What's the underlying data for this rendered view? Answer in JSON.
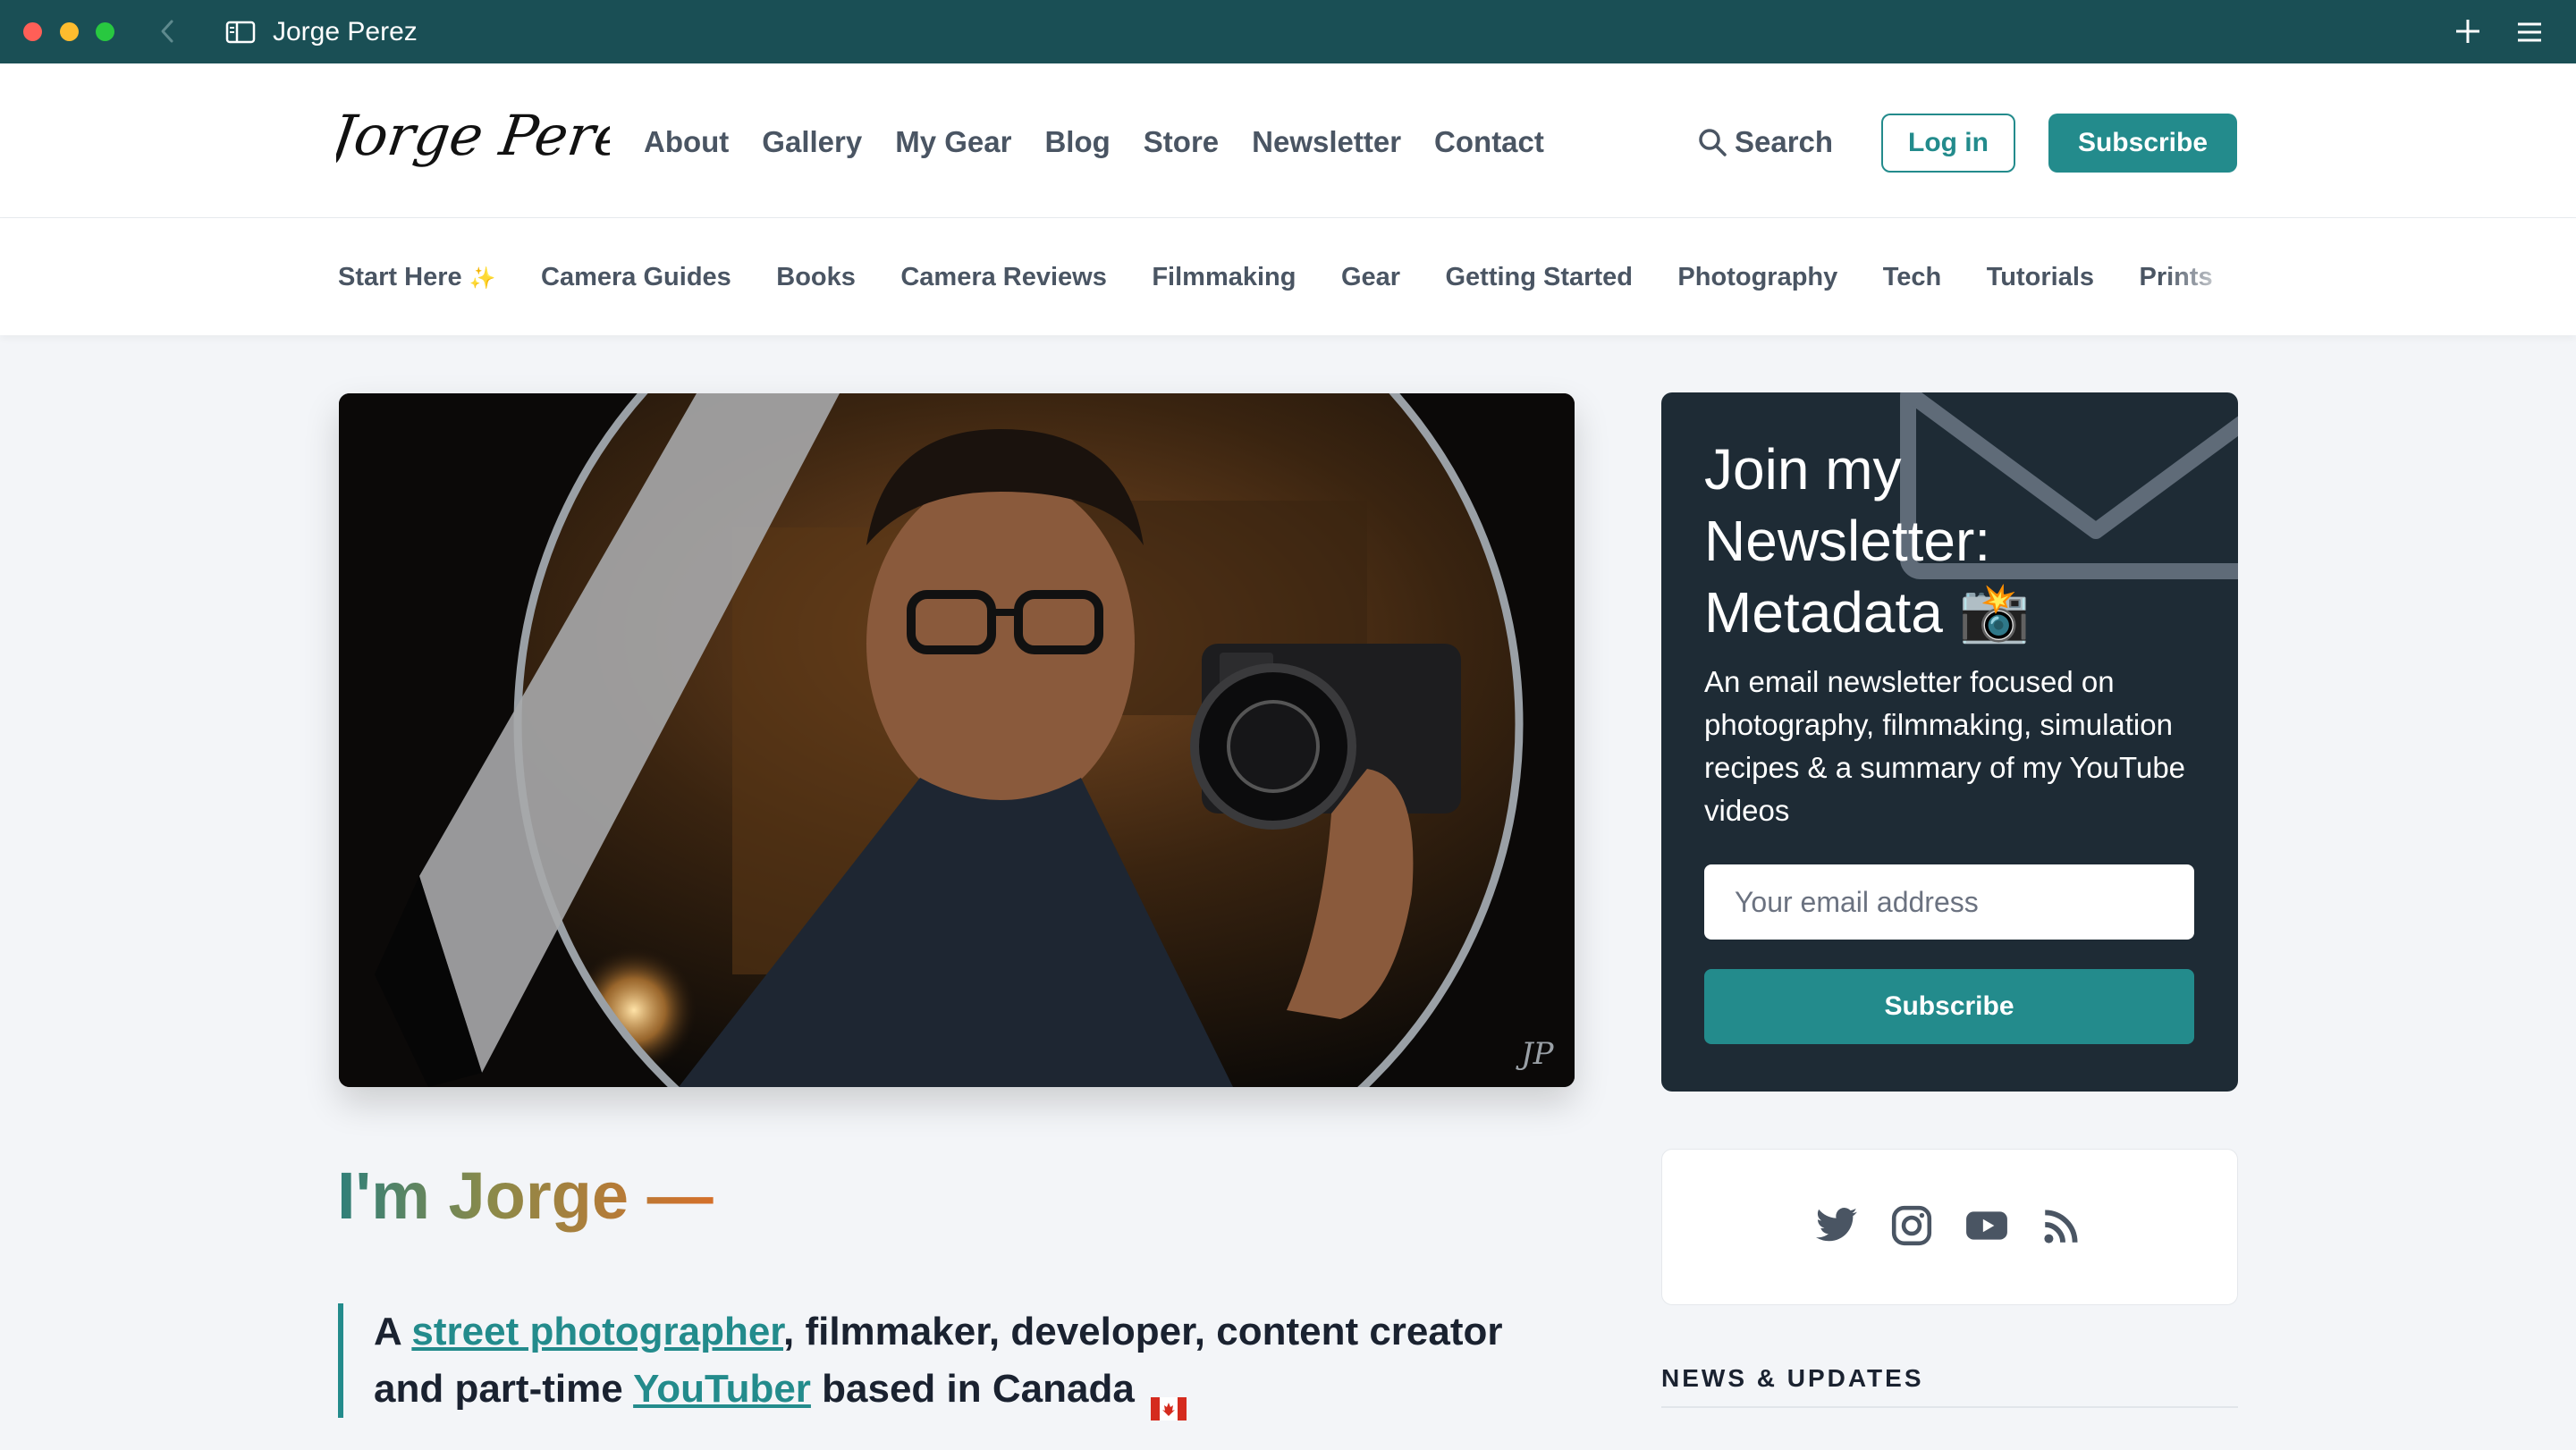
{
  "browser": {
    "tab_title": "Jorge Perez"
  },
  "header": {
    "logo_text": "Jorge Perez",
    "nav": [
      {
        "label": "About"
      },
      {
        "label": "Gallery"
      },
      {
        "label": "My Gear"
      },
      {
        "label": "Blog"
      },
      {
        "label": "Store"
      },
      {
        "label": "Newsletter"
      },
      {
        "label": "Contact"
      }
    ],
    "search_label": "Search",
    "login_label": "Log in",
    "subscribe_label": "Subscribe"
  },
  "categories": [
    {
      "label": "Start Here"
    },
    {
      "label": "Camera Guides"
    },
    {
      "label": "Books"
    },
    {
      "label": "Camera Reviews"
    },
    {
      "label": "Filmmaking"
    },
    {
      "label": "Gear"
    },
    {
      "label": "Getting Started"
    },
    {
      "label": "Photography"
    },
    {
      "label": "Tech"
    },
    {
      "label": "Tutorials"
    },
    {
      "label": "Prints"
    }
  ],
  "hero": {
    "watermark": "JP"
  },
  "intro": {
    "heading": "I'm Jorge —",
    "quote": {
      "prefix": "A ",
      "link1": "street photographer",
      "middle": ", filmmaker, developer, content creator and part-time ",
      "link2": "YouTuber",
      "suffix": " based in Canada"
    }
  },
  "newsletter": {
    "title": "Join my Newsletter: Metadata",
    "emoji": "📸",
    "description": "An email newsletter focused on photography, filmmaking, simulation recipes & a summary of my YouTube videos",
    "email_placeholder": "Your email address",
    "button_label": "Subscribe"
  },
  "social": {
    "icons": [
      "twitter-icon",
      "instagram-icon",
      "youtube-icon",
      "rss-icon"
    ]
  },
  "news": {
    "heading": "NEWS & UPDATES"
  },
  "colors": {
    "chrome": "#1a4f55",
    "accent": "#238b8c",
    "card_dark": "#1e2b35",
    "page_bg": "#f3f5f8"
  }
}
